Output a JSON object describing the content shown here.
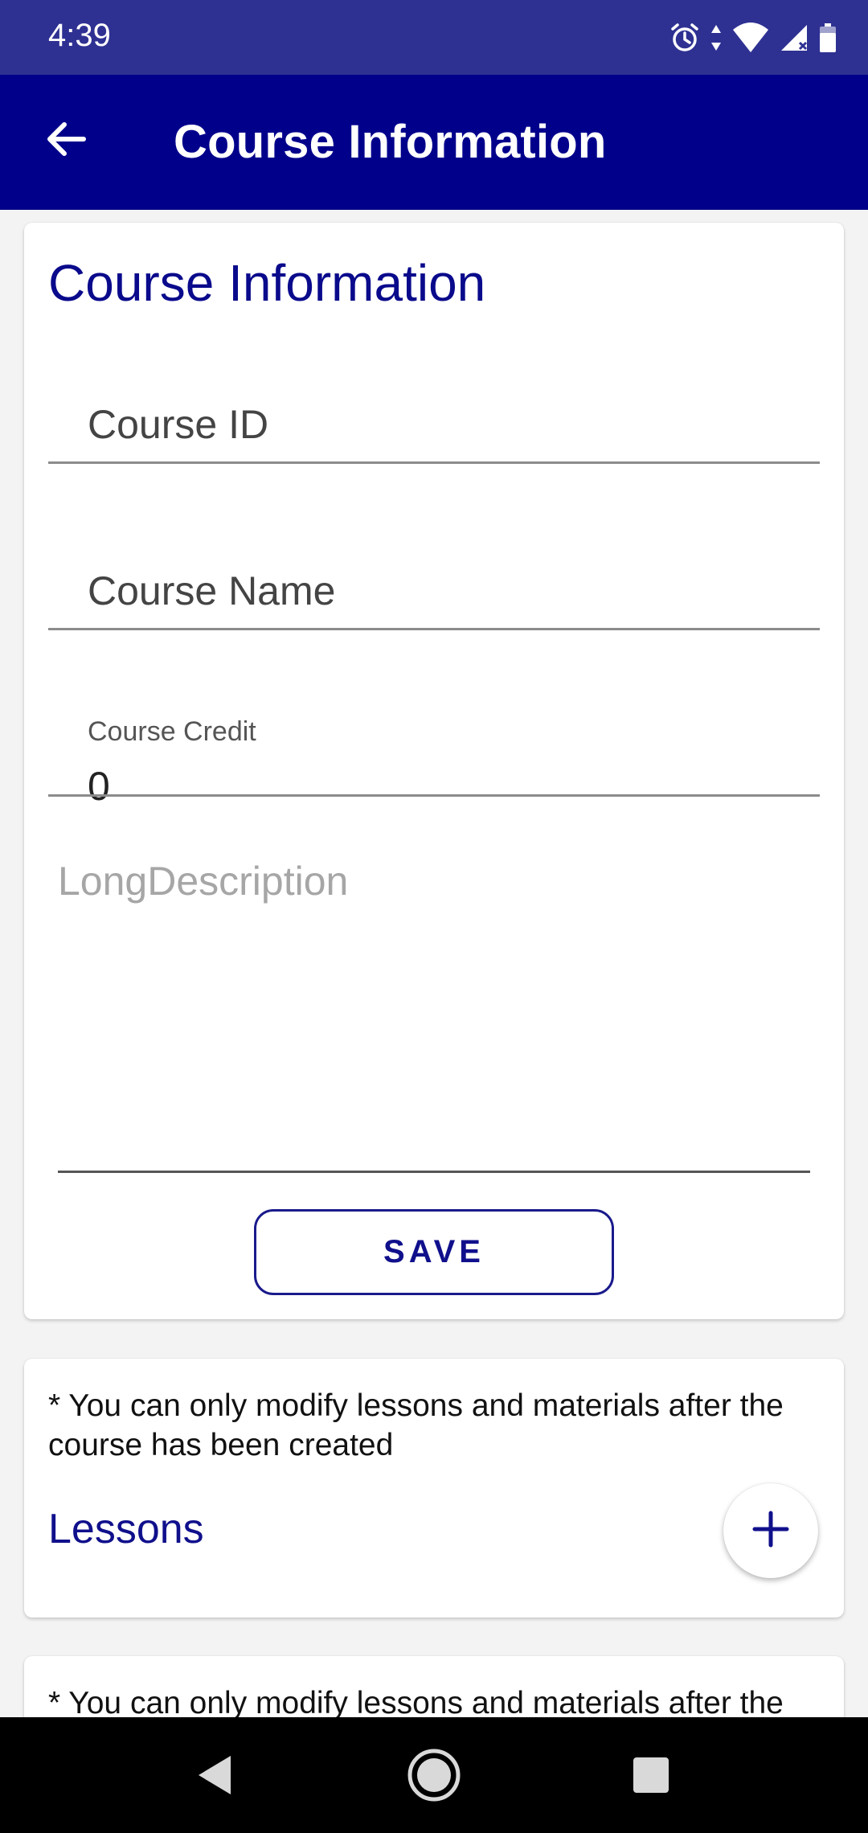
{
  "status_bar": {
    "time": "4:39",
    "icons": [
      "alarm-icon",
      "data-arrows-icon",
      "wifi-icon",
      "cell-signal-icon",
      "battery-icon"
    ]
  },
  "app_bar": {
    "back_icon": "arrow-left-icon",
    "title": "Course Information"
  },
  "form": {
    "heading": "Course Information",
    "course_id_label": "Course ID",
    "course_name_label": "Course Name",
    "course_credit_label": "Course Credit",
    "course_credit_value": "0",
    "long_description_placeholder": "LongDescription",
    "save_label": "SAVE"
  },
  "lessons": {
    "note": "* You can only modify lessons and materials after the course has been created",
    "label": "Lessons",
    "add_icon": "plus-icon"
  },
  "materials": {
    "note": "* You can only modify lessons and materials after the course has been created"
  },
  "nav_bar": {
    "buttons": [
      "back-triangle-icon",
      "home-circle-icon",
      "recents-square-icon"
    ]
  },
  "colors": {
    "status_bar": "#2e3192",
    "app_bar": "#00008b",
    "accent": "#10108c",
    "background": "#f3f3f3"
  }
}
